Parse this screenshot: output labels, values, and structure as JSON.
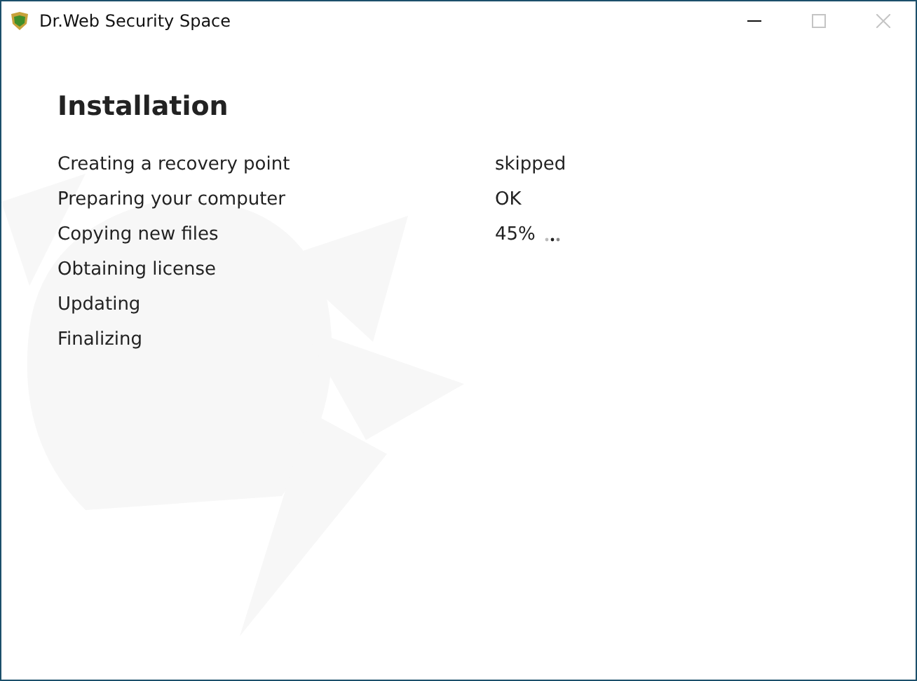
{
  "window": {
    "title": "Dr.Web Security Space",
    "controls": [
      {
        "kind": "minimize",
        "disabled": false
      },
      {
        "kind": "maximize",
        "disabled": true
      },
      {
        "kind": "close",
        "disabled": true
      }
    ]
  },
  "heading": "Installation",
  "steps": [
    {
      "label": "Creating a recovery point",
      "status": "skipped",
      "busy": false
    },
    {
      "label": "Preparing your computer",
      "status": "OK",
      "busy": false
    },
    {
      "label": "Copying new files",
      "status": "45%",
      "busy": true
    },
    {
      "label": "Obtaining license",
      "busy": false
    },
    {
      "label": "Updating",
      "busy": false
    },
    {
      "label": "Finalizing",
      "busy": false
    }
  ]
}
